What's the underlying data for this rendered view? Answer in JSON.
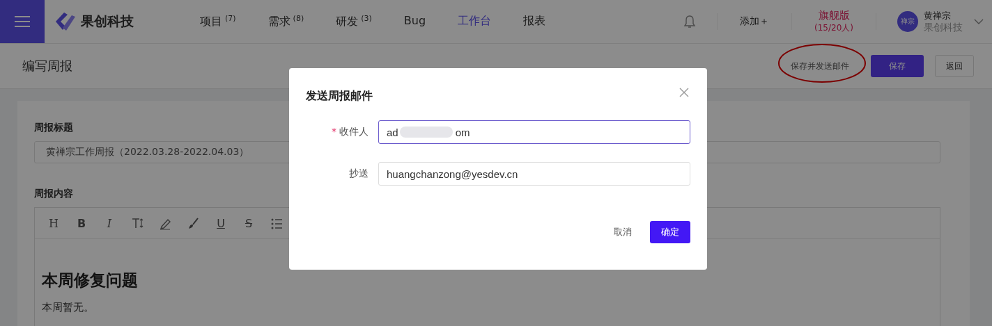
{
  "header": {
    "brand": "果创科技",
    "nav": [
      {
        "label": "项目",
        "count": "(7)",
        "selected": false
      },
      {
        "label": "需求",
        "count": "(8)",
        "selected": false
      },
      {
        "label": "研发",
        "count": "(3)",
        "selected": false
      },
      {
        "label": "Bug",
        "selected": false
      },
      {
        "label": "工作台",
        "selected": true
      },
      {
        "label": "报表",
        "selected": false
      }
    ],
    "add": "添加＋",
    "plan": {
      "name": "旗舰版",
      "seats": "(15/20人)"
    },
    "user": {
      "avatar": "禅宗",
      "name": "黄禅宗",
      "org": "果创科技"
    }
  },
  "page": {
    "title": "编写周报",
    "actions": [
      {
        "kind": "text",
        "label": "保存并发送邮件",
        "circled": true
      },
      {
        "kind": "primary",
        "label": "保存"
      },
      {
        "kind": "outline",
        "label": "返回"
      }
    ]
  },
  "form": {
    "title_label": "周报标题",
    "title_value": "黄禅宗工作周报（2022.03.28-2022.04.03）",
    "content_label": "周报内容",
    "toolbar": [
      {
        "kind": "heading",
        "label": "H"
      },
      {
        "kind": "bold",
        "label": "B"
      },
      {
        "kind": "italic",
        "label": "I"
      },
      {
        "kind": "textsize"
      },
      {
        "kind": "pen"
      },
      {
        "kind": "brush"
      },
      {
        "kind": "underline",
        "label": "U"
      },
      {
        "kind": "strike",
        "label": "S"
      },
      {
        "kind": "list"
      }
    ],
    "heading": "本周修复问题",
    "paragraph": "本周暂无。"
  },
  "dialog": {
    "title": "发送周报邮件",
    "fields": [
      {
        "required_mark": "*",
        "label": "收件人",
        "focused": true,
        "value_parts": [
          {
            "kind": "text",
            "text": "ad"
          },
          {
            "kind": "redaction"
          },
          {
            "kind": "text",
            "text": "om"
          }
        ]
      },
      {
        "label": "抄送",
        "focused": false,
        "value_parts": [
          {
            "kind": "text",
            "text": "huangchanzong@yesdev.cn"
          }
        ]
      }
    ],
    "cancel": "取消",
    "confirm": "确定"
  }
}
